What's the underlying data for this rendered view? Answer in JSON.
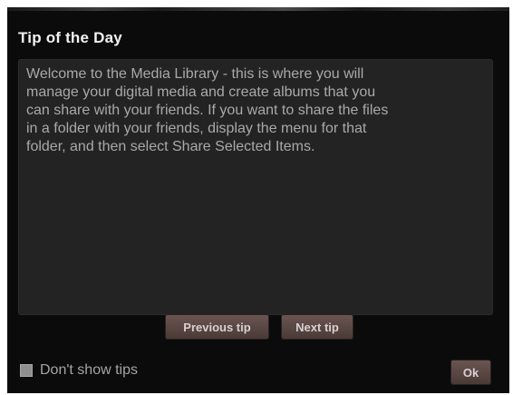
{
  "dialog": {
    "title": "Tip of the Day",
    "tip_text": "Welcome to the Media Library - this is where you will\nmanage your digital media and create albums that you\ncan share with your friends. If you want to share the files\nin a folder with your friends, display the menu for that\nfolder, and then select Share Selected Items.",
    "buttons": {
      "previous_label": "Previous tip",
      "next_label": "Next tip",
      "ok_label": "Ok"
    },
    "dont_show": {
      "label": "Don't show tips",
      "checked": false
    }
  }
}
